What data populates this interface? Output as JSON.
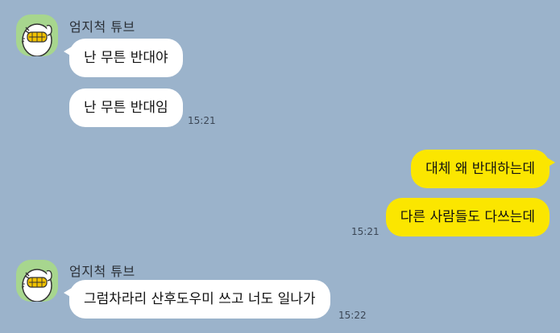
{
  "colors": {
    "background": "#9bb3cb",
    "incoming_bubble": "#ffffff",
    "outgoing_bubble": "#fbe600",
    "avatar_bg": "#a7d68e"
  },
  "messages": {
    "group1": {
      "sender": "엄지척 튜브",
      "avatar_icon": "thumbs-up-character-avatar",
      "bubble1": "난 무튼 반대야",
      "bubble2": "난 무튼 반대임",
      "time": "15:21"
    },
    "group2": {
      "bubble1": "대체 왜 반대하는데",
      "bubble2": "다른 사람들도 다쓰는데",
      "time": "15:21"
    },
    "group3": {
      "sender": "엄지척 튜브",
      "avatar_icon": "thumbs-up-character-avatar",
      "bubble1": "그럼차라리 산후도우미 쓰고 너도 일나가",
      "time": "15:22"
    }
  }
}
